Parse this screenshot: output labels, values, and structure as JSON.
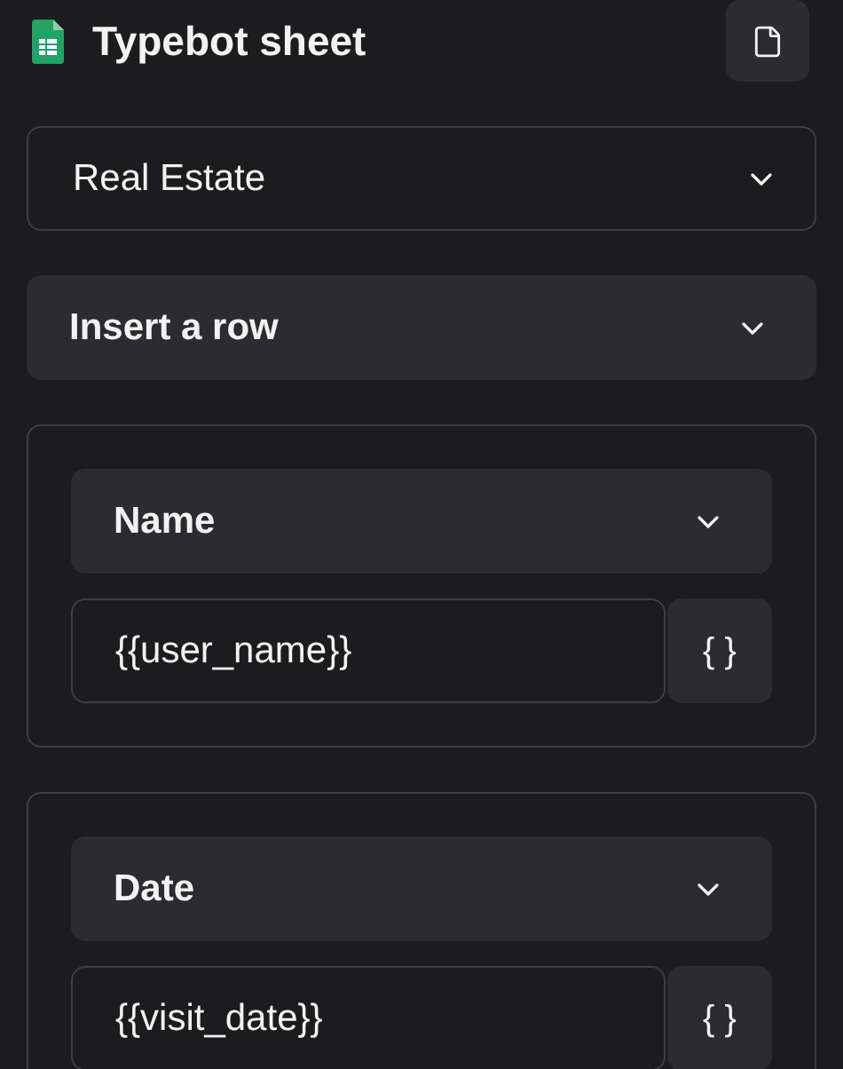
{
  "header": {
    "title": "Typebot sheet"
  },
  "sheet_select": {
    "value": "Real Estate"
  },
  "action_select": {
    "value": "Insert a row"
  },
  "rows": [
    {
      "column": "Name",
      "value": "{{user_name}}",
      "variable_button": "{ }"
    },
    {
      "column": "Date",
      "value": "{{visit_date}}",
      "variable_button": "{ }"
    }
  ]
}
